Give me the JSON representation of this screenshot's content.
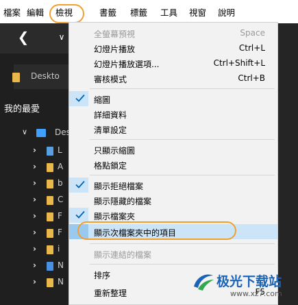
{
  "menubar": {
    "items": [
      "檔案",
      "編輯",
      "檢視",
      "書籤",
      "標籤",
      "工具",
      "視窗",
      "說明"
    ],
    "active": "檢視"
  },
  "explorer": {
    "address_text": "Deskto",
    "favorites_title": "我的最愛",
    "tree_root_label": "Des",
    "tree_rows": [
      "L",
      "A",
      "b",
      "C",
      "F",
      "F",
      "i",
      "N",
      "N"
    ]
  },
  "view_menu": {
    "items": [
      {
        "label": "全螢幕預視",
        "shortcut": "Space",
        "disabled": true,
        "checked": false
      },
      {
        "label": "幻燈片播放",
        "shortcut": "Ctrl+L",
        "disabled": false,
        "checked": false
      },
      {
        "label": "幻燈片播放選項...",
        "shortcut": "Ctrl+Shift+L",
        "disabled": false,
        "checked": false
      },
      {
        "label": "審核模式",
        "shortcut": "Ctrl+B",
        "disabled": false,
        "checked": false
      },
      {
        "label": "縮圖",
        "shortcut": "",
        "disabled": false,
        "checked": true
      },
      {
        "label": "詳細資料",
        "shortcut": "",
        "disabled": false,
        "checked": false
      },
      {
        "label": "清單設定",
        "shortcut": "",
        "disabled": false,
        "checked": false
      },
      {
        "label": "只顯示縮圖",
        "shortcut": "",
        "disabled": false,
        "checked": false
      },
      {
        "label": "格點鎖定",
        "shortcut": "",
        "disabled": false,
        "checked": false
      },
      {
        "label": "顯示拒絕檔案",
        "shortcut": "",
        "disabled": false,
        "checked": true
      },
      {
        "label": "顯示隱藏的檔案",
        "shortcut": "",
        "disabled": false,
        "checked": false
      },
      {
        "label": "顯示檔案夾",
        "shortcut": "",
        "disabled": false,
        "checked": true
      },
      {
        "label": "顯示次檔案夾中的項目",
        "shortcut": "",
        "disabled": false,
        "checked": false,
        "highlighted": true
      },
      {
        "label": "顯示連結的檔案",
        "shortcut": "",
        "disabled": true,
        "checked": false
      },
      {
        "label": "排序",
        "shortcut": "",
        "disabled": false,
        "checked": false
      },
      {
        "label": "重新整理",
        "shortcut": "F5",
        "disabled": false,
        "checked": false
      }
    ]
  },
  "watermark": {
    "brand": "极光下载站",
    "url": "www.xz7.com"
  },
  "colors": {
    "highlight": "#cce4f7",
    "check_accent": "#0063b1",
    "annotation_ring": "#f0a030",
    "folder": "#e9b84a"
  }
}
